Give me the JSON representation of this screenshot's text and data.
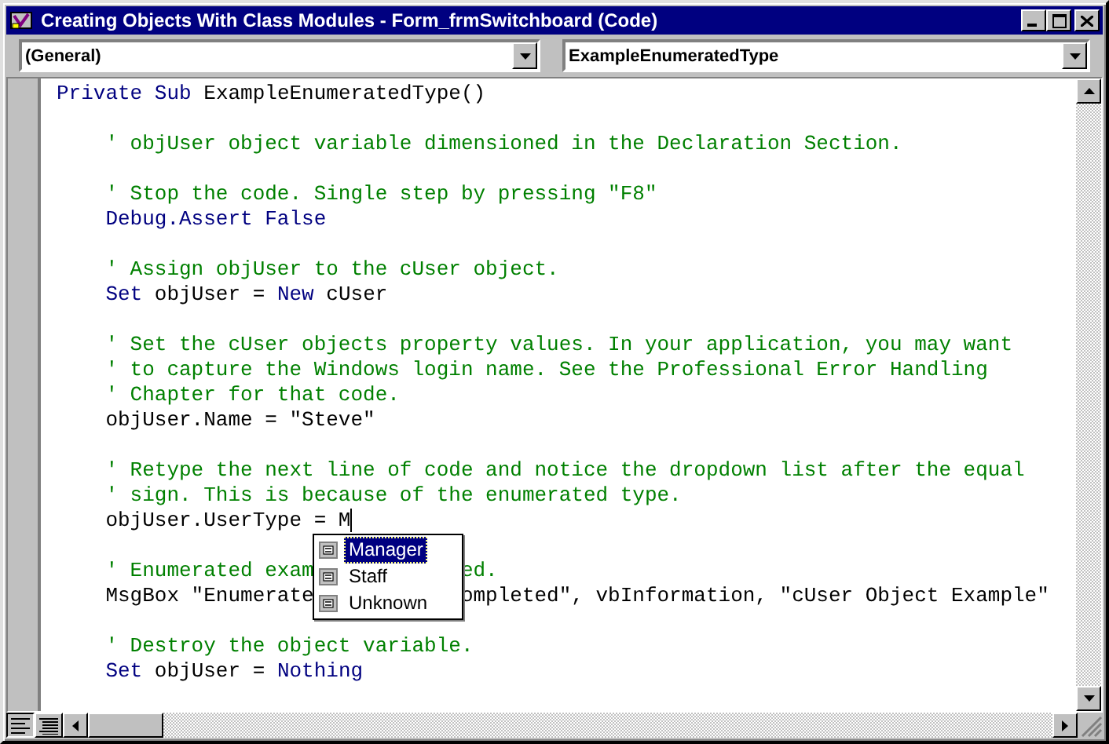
{
  "window": {
    "title": "Creating Objects With Class Modules - Form_frmSwitchboard (Code)"
  },
  "object_combo": {
    "value": "(General)"
  },
  "procedure_combo": {
    "value": "ExampleEnumeratedType"
  },
  "code": {
    "header": [
      {
        "kind": "keyword",
        "text": "Private Sub"
      },
      {
        "kind": "plain",
        "text": "ExampleEnumeratedType()"
      }
    ],
    "body": [
      [
        {
          "caret": false,
          "tokens": [
            {
              "kind": "comment",
              "text": "' objUser object variable dimensioned in the Declaration Section."
            }
          ]
        }
      ],
      [
        {
          "caret": false,
          "tokens": [
            {
              "kind": "comment",
              "text": "' Stop the code. Single step by pressing \"F8\""
            }
          ]
        },
        {
          "caret": false,
          "tokens": [
            {
              "kind": "keyword",
              "text": "Debug.Assert False"
            }
          ]
        }
      ],
      [
        {
          "caret": false,
          "tokens": [
            {
              "kind": "comment",
              "text": "' Assign objUser to the cUser object."
            }
          ]
        },
        {
          "caret": false,
          "tokens": [
            {
              "kind": "keyword",
              "text": "Set"
            },
            {
              "kind": "plain",
              "text": "objUser ="
            },
            {
              "kind": "keyword",
              "text": "New"
            },
            {
              "kind": "plain",
              "text": "cUser"
            }
          ]
        }
      ],
      [
        {
          "caret": false,
          "tokens": [
            {
              "kind": "comment",
              "text": "' Set the cUser objects property values. In your application, you may want"
            }
          ]
        },
        {
          "caret": false,
          "tokens": [
            {
              "kind": "comment",
              "text": "' to capture the Windows login name. See the Professional Error Handling"
            }
          ]
        },
        {
          "caret": false,
          "tokens": [
            {
              "kind": "comment",
              "text": "' Chapter for that code."
            }
          ]
        },
        {
          "caret": false,
          "tokens": [
            {
              "kind": "plain",
              "text": "objUser.Name = \"Steve\""
            }
          ]
        }
      ],
      [
        {
          "caret": false,
          "tokens": [
            {
              "kind": "comment",
              "text": "' Retype the next line of code and notice the dropdown list after the equal"
            }
          ]
        },
        {
          "caret": false,
          "tokens": [
            {
              "kind": "comment",
              "text": "' sign. This is because of the enumerated type."
            }
          ]
        },
        {
          "caret": true,
          "tokens": [
            {
              "kind": "plain",
              "text": "objUser.UserType = M"
            }
          ]
        }
      ],
      [
        {
          "caret": false,
          "tokens": [
            {
              "kind": "comment",
              "text": "' Enumerated exam"
            },
            {
              "kind": "gap"
            },
            {
              "kind": "comment",
              "text": "ed."
            }
          ]
        },
        {
          "caret": false,
          "tokens": [
            {
              "kind": "plain",
              "text": "MsgBox \"Enumerate"
            },
            {
              "kind": "gap"
            },
            {
              "kind": "plain",
              "text": "ompleted\", vbInformation, \"cUser Object Example\""
            }
          ]
        }
      ],
      [
        {
          "caret": false,
          "tokens": [
            {
              "kind": "comment",
              "text": "' Destroy the object variable."
            }
          ]
        },
        {
          "caret": false,
          "tokens": [
            {
              "kind": "keyword",
              "text": "Set"
            },
            {
              "kind": "plain",
              "text": "objUser ="
            },
            {
              "kind": "keyword",
              "text": "Nothing"
            }
          ]
        }
      ]
    ]
  },
  "completion_list": {
    "items": [
      {
        "label": "Manager",
        "selected": true
      },
      {
        "label": "Staff",
        "selected": false
      },
      {
        "label": "Unknown",
        "selected": false
      }
    ]
  }
}
